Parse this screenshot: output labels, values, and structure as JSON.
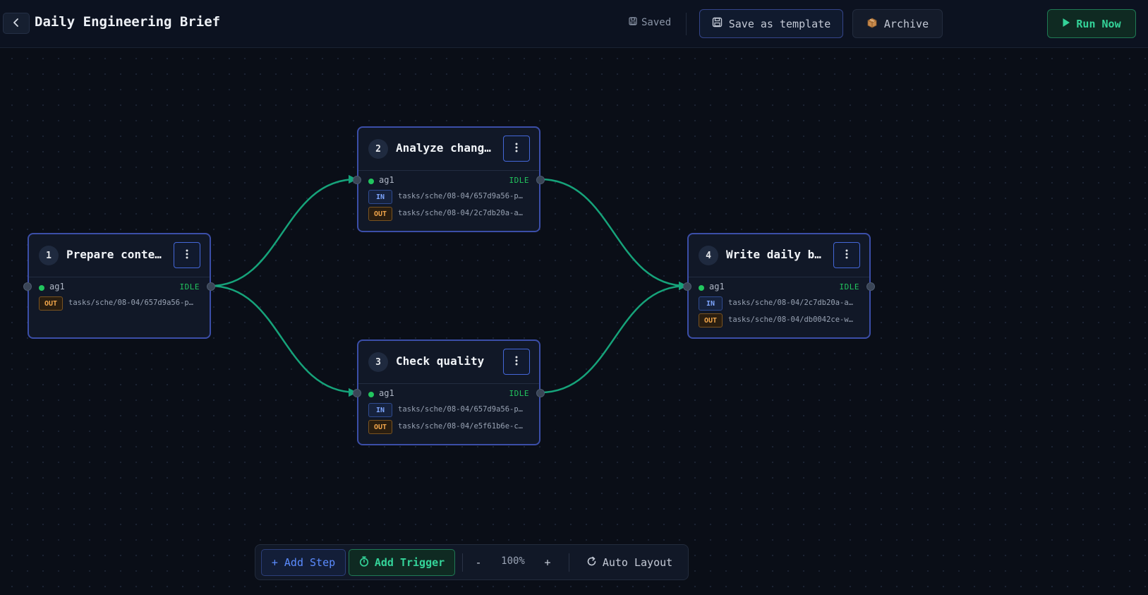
{
  "header": {
    "title": "Daily Engineering Brief",
    "saved_label": "Saved",
    "save_template_label": "Save as template",
    "archive_label": "Archive",
    "run_label": "Run Now"
  },
  "colors": {
    "accent_blue": "#3b4ea8",
    "run_green": "#34d399",
    "edge": "#16a37a",
    "status_idle": "#22c55e",
    "out_badge": "#f0a54a",
    "in_badge": "#7ea6ff"
  },
  "icons": {
    "back": "chevron-left-icon",
    "saved": "floppy-disk-icon",
    "save_template": "floppy-disk-icon",
    "archive": "package-icon",
    "run": "play-icon",
    "node_menu": "vertical-ellipsis-icon",
    "add_trigger": "stopwatch-icon",
    "auto_layout": "refresh-icon"
  },
  "nodes": [
    {
      "number": "1",
      "title": "Prepare conte…",
      "agent": "ag1",
      "status": "IDLE",
      "io": [
        {
          "kind": "OUT",
          "path": "tasks/sche/08-04/657d9a56-p…"
        }
      ]
    },
    {
      "number": "2",
      "title": "Analyze chang…",
      "agent": "ag1",
      "status": "IDLE",
      "io": [
        {
          "kind": "IN",
          "path": "tasks/sche/08-04/657d9a56-p…"
        },
        {
          "kind": "OUT",
          "path": "tasks/sche/08-04/2c7db20a-a…"
        }
      ]
    },
    {
      "number": "3",
      "title": "Check quality",
      "agent": "ag1",
      "status": "IDLE",
      "io": [
        {
          "kind": "IN",
          "path": "tasks/sche/08-04/657d9a56-p…"
        },
        {
          "kind": "OUT",
          "path": "tasks/sche/08-04/e5f61b6e-c…"
        }
      ]
    },
    {
      "number": "4",
      "title": "Write daily b…",
      "agent": "ag1",
      "status": "IDLE",
      "io": [
        {
          "kind": "IN",
          "path": "tasks/sche/08-04/2c7db20a-a…"
        },
        {
          "kind": "OUT",
          "path": "tasks/sche/08-04/db0042ce-w…"
        }
      ]
    }
  ],
  "toolbar": {
    "add_step_label": "+ Add Step",
    "add_trigger_label": "Add Trigger",
    "zoom_out_label": "-",
    "zoom_level": "100%",
    "zoom_in_label": "+",
    "auto_layout_label": "Auto Layout"
  }
}
